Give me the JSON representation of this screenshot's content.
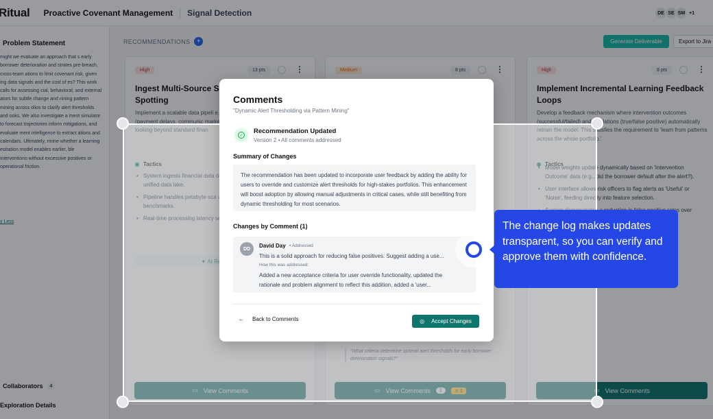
{
  "app": {
    "logo": "Ritual",
    "breadcrumb": [
      "Proactive Covenant Management",
      "Signal Detection"
    ],
    "avatars": [
      "DE",
      "SE",
      "SM",
      "+1"
    ]
  },
  "left_panel": {
    "title": "Problem Statement",
    "text": "might we evaluate an approach that s early borrower deterioration and strates pre-breach, cross-team ations to limit covenant risk, given ing data signals and the cost of es? This work calls for assessing cial, behavioral, and external ators for subtle change and nining pattern mining across olios to clarify alert thresholds and ooks. We also investigate a ment simulator to forecast trajectories inform mitigations, and evaluate ment intelligence to extract ations and calendars. Ultimately, rmine whether a learning estration model enables earlier, ble interventions without excessive positives or operational friction.",
    "link": "y Less",
    "collaborators_label": "Collaborators",
    "collaborators_count": "4",
    "exploration_label": "Exploration Details"
  },
  "recommendations": {
    "header": "RECOMMENDATIONS",
    "plus": "+",
    "generate": "Generate Deliverable",
    "export": "Export to Jira"
  },
  "cards": [
    {
      "priority": "High",
      "points": "13 pts",
      "title": "Ingest Multi-Source Sig Deterioration Spotting",
      "desc": "Implement a scalable data pipeli e.g., Apache Spark) to ingest an logs (payment delays, communic market data. This directly addres by looking beyond standard finan",
      "tactics_label": "Tactics",
      "tactics": [
        "System ingests financial data data (transaction logs), and ex a unified data lake.",
        "Pipeline handles petabyte-sca with 10x portfolio growth as p benchmarks.",
        "Real-time processing latency seconds to enable 'sooner' ac"
      ],
      "ai_label": "AI Reasoning",
      "view_comments": "View Comments"
    },
    {
      "priority": "Medium",
      "points": "8 pts",
      "quote": "\"What criteria determine optimal alert thresholds for early borrower deterioration signals?\"",
      "view_comments": "View Comments",
      "comment_count": "1",
      "warning_count": "1"
    },
    {
      "priority": "High",
      "points": "8 pts",
      "title": "Implement Incremental Learning Feedback Loops",
      "desc": "Develop a feedback mechanism where intervention outcomes (successful/failed) and validations (true/false positive) automatically retrain the model. This satisfies the requirement to 'learn from patterns across the whole portfolio.'",
      "tactics_label": "Tactics",
      "tactics": [
        "Model weights update dynamically based on 'Intervention Outcome' data (e.g., did the borrower default after the alert?).",
        "User interface allows risk officers to flag alerts as 'Useful' or 'Noise', feeding directly into feature selection.",
        "System demonstrates a reduction in false positive rates over"
      ],
      "view_comments": "View Comments"
    }
  ],
  "modal": {
    "title": "Comments",
    "subtitle": "\"Dynamic Alert Thresholding via Pattern Mining\"",
    "status_title": "Recommendation Updated",
    "status_sub": "Version 2 • All comments addressed",
    "summary_label": "Summary of Changes",
    "summary": "The recommendation has been updated to incorporate user feedback by adding the ability for users to override and customize alert thresholds for high-stakes portfolios. This enhancement will boost adoption by allowing manual adjustments in critical cases, while still benefiting from dynamic thresholding for most scenarios.",
    "changes_label": "Changes by Comment (1)",
    "comment": {
      "initials": "DD",
      "author": "David Day",
      "status": "• Addressed",
      "text": "This is a solid approach for reducing false positives. Suggest adding a use...",
      "how_label": "How this was addressed:",
      "addressed": "Added a new acceptance criteria for user override functionality, updated the rationale and problem alignment to reflect this addition, added a 'user..."
    },
    "back": "Back to Comments",
    "accept": "Accept Changes"
  },
  "tooltip": {
    "text": "The change log makes updates transparent, so you can verify and approve them with confidence."
  }
}
